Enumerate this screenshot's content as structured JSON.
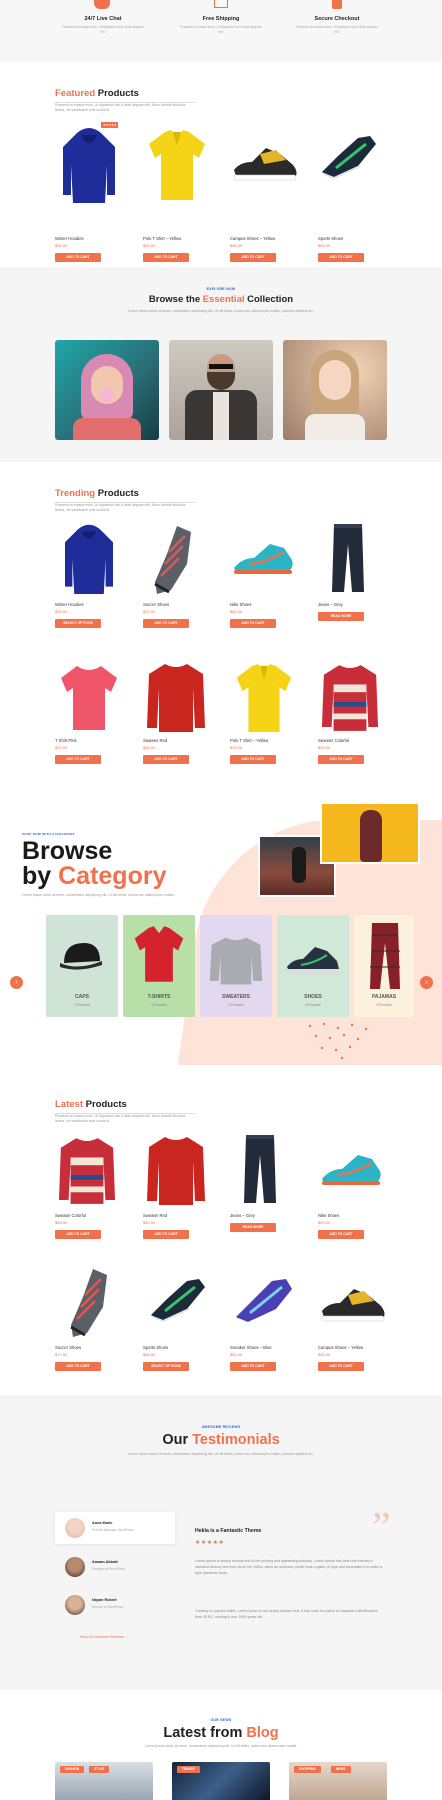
{
  "features": [
    {
      "title": "24/7 Live Chat",
      "desc": "Praesent at massa enim. Ut dignissim nisl a vitae aliquam elit."
    },
    {
      "title": "Free Shipping",
      "desc": "Praesent at massa enim. Ut dignissim nisl a vitae aliquam elit."
    },
    {
      "title": "Secure Checkout",
      "desc": "Praesent at massa enim. Ut dignissim nisl a vitae aliquam elit."
    }
  ],
  "featured": {
    "title_accent": "Featured",
    "title_rest": " Products",
    "subtitle": "Praesent at massa enim. Ut dignissim nisl a vitae aliquam elit. Nunc blandit faucibus lectus, vel vestibulum erat luctus id.",
    "products": [
      {
        "name": "Winter Hoodies",
        "price": "$39.00",
        "button": "ADD TO CART",
        "badge": "★★★★★"
      },
      {
        "name": "Polo T Shirt – Yellow",
        "price": "$25.00",
        "button": "ADD TO CART"
      },
      {
        "name": "Campus Shoes – Yellow",
        "price": "$85.00",
        "button": "ADD TO CART"
      },
      {
        "name": "Sports Shoes",
        "price": "$65.00",
        "button": "ADD TO CART"
      }
    ]
  },
  "collection": {
    "eyebrow": "EXPLORE NOW",
    "title_pre": "Browse the ",
    "title_accent": "Essential",
    "title_post": " Collection",
    "subtitle": "Lorem ipsum dolor sit amet, consectetur adipiscing elit. Ut elit tellus, luctus nec ullamcorper mattis, pulvinar dapibus leo."
  },
  "trending": {
    "title_accent": "Trending",
    "title_rest": " Products",
    "subtitle": "Praesent at massa enim. Ut dignissim nisl a vitae aliquam elit. Nunc blandit faucibus lectus, vel vestibulum erat luctus id.",
    "products": [
      {
        "name": "Winter Hoodies",
        "price": "$39.00",
        "button": "SELECT OPTIONS"
      },
      {
        "name": "Soccer Shoes",
        "price": "$70.00",
        "button": "ADD TO CART"
      },
      {
        "name": "Nike Shoes",
        "price": "$60.00",
        "button": "ADD TO CART"
      },
      {
        "name": "Jeans – Grey",
        "price": "",
        "button": "READ MORE"
      },
      {
        "name": "T Shirt Pink",
        "price": "$20.00",
        "button": "ADD TO CART"
      },
      {
        "name": "Sweater Red",
        "price": "$45.00",
        "button": "ADD TO CART"
      },
      {
        "name": "Polo T Shirt – Yellow",
        "price": "$25.00",
        "button": "ADD TO CART"
      },
      {
        "name": "Sweater Colorful",
        "price": "$55.00",
        "button": "ADD TO CART"
      }
    ]
  },
  "category": {
    "eyebrow": "SHOP NOW WITH CATEGORIES",
    "title_line1": "Browse",
    "title_line2_pre": "by ",
    "title_line2_accent": "Category",
    "subtitle": "Lorem ipsum dolor sit amet, consectetur adipiscing elit. Ut elit tellus, luctus nec ullamcorper mattis.",
    "cards": [
      {
        "label": "CAPS",
        "count": "3 Products",
        "color": "#cfe3d6"
      },
      {
        "label": "T-SHIRTS",
        "count": "4 Products",
        "color": "#b7dfa7"
      },
      {
        "label": "SWEATERS",
        "count": "3 Products",
        "color": "#e2d8ef"
      },
      {
        "label": "SHOES",
        "count": "6 Products",
        "color": "#cfe8d8"
      },
      {
        "label": "PAJAMAS",
        "count": "2 Products",
        "color": "#fbf1dd"
      }
    ]
  },
  "latest": {
    "title_accent": "Latest",
    "title_rest": " Products",
    "subtitle": "Praesent at massa enim. Ut dignissim nisl a vitae aliquam elit. Nunc blandit faucibus lectus, vel vestibulum erat luctus id.",
    "products": [
      {
        "name": "Sweater Colorful",
        "price": "$55.00",
        "button": "ADD TO CART"
      },
      {
        "name": "Sweater Red",
        "price": "$45.00",
        "button": "ADD TO CART"
      },
      {
        "name": "Jeans – Grey",
        "price": "",
        "button": "READ MORE"
      },
      {
        "name": "Nike Shoes",
        "price": "$60.00",
        "button": "ADD TO CART"
      },
      {
        "name": "Soccer Shoes",
        "price": "$70.00",
        "button": "ADD TO CART"
      },
      {
        "name": "Sports Shoes",
        "price": "$65.00",
        "button": "SELECT OPTIONS"
      },
      {
        "name": "Sneaker Shoes – Blue",
        "price": "$80.00",
        "button": "ADD TO CART"
      },
      {
        "name": "Campus Shoes – Yellow",
        "price": "$85.00",
        "button": "ADD TO CART"
      }
    ]
  },
  "testimonials": {
    "eyebrow": "AWESOME REVIEWS",
    "title_pre": "Our ",
    "title_accent": "Testimonials",
    "subtitle": "Lorem ipsum dolor sit amet, consectetur adipiscing elit. Ut elit tellus, luctus nec ullamcorper mattis, pulvinar dapibus leo.",
    "people": [
      {
        "name": "Anna Marie",
        "role": "Product Manager, WordPress"
      },
      {
        "name": "Amaan Abbott",
        "role": "Designer at WordPress"
      },
      {
        "name": "Nayan Robert",
        "role": "Director at WordPress"
      }
    ],
    "quote_title": "Hekla is a Fantastic Theme",
    "stars": "★★★★★",
    "quote_p1": "Lorem Ipsum is simply dummy text of the printing and typesetting industry. Lorem Ipsum has been the industry's standard dummy text ever since the 1500s, when an unknown printer took a galley of type and scrambled it to make a type specimen book.",
    "quote_p2": "Contrary to popular belief, Lorem Ipsum is not simply random text. It has roots in a piece of classical Latin literature from 45 BC, making it over 2000 years old.",
    "link": "View All Customer Reviews →"
  },
  "blog": {
    "eyebrow": "OUR NEWS",
    "title_pre": "Latest from ",
    "title_accent": "Blog",
    "subtitle": "Lorem ipsum dolor sit amet, consectetur adipiscing elit. Ut elit tellus, luctus nec ullamcorper mattis.",
    "tags": [
      "FASHION",
      "STYLE",
      "TRENDS",
      "SHOPPING",
      "NEWS"
    ]
  }
}
